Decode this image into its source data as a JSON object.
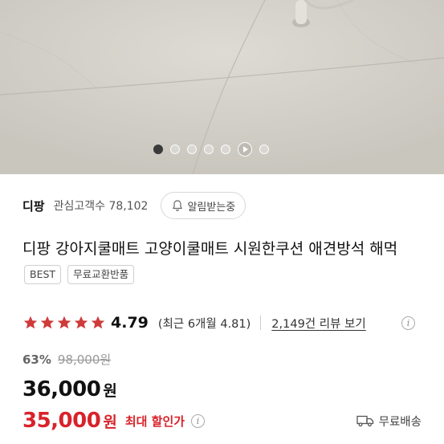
{
  "carousel": {
    "total_dots": 7,
    "active_index": 0,
    "play_index": 5
  },
  "seller": {
    "name": "디팡",
    "followers_label": "관심고객수 78,102",
    "follow_button": "알림받는중"
  },
  "product": {
    "title": "디팡 강아지쿨매트 고양이쿨매트 시원한쿠션 애견방석 해먹",
    "tags": [
      "BEST",
      "무료교환반품"
    ]
  },
  "rating": {
    "stars": 5,
    "score": "4.79",
    "recent": "(최근 6개월 4.81)",
    "reviews_link": "2,149건 리뷰 보기"
  },
  "pricing": {
    "discount_rate": "63%",
    "original_price": "98,000원",
    "sale_price": "36,000",
    "currency": "원",
    "max_discount_price": "35,000",
    "max_discount_label": "최대 할인가",
    "shipping": "무료배송"
  },
  "colors": {
    "accent_red": "#d8232a",
    "star": "#d03a3a"
  }
}
